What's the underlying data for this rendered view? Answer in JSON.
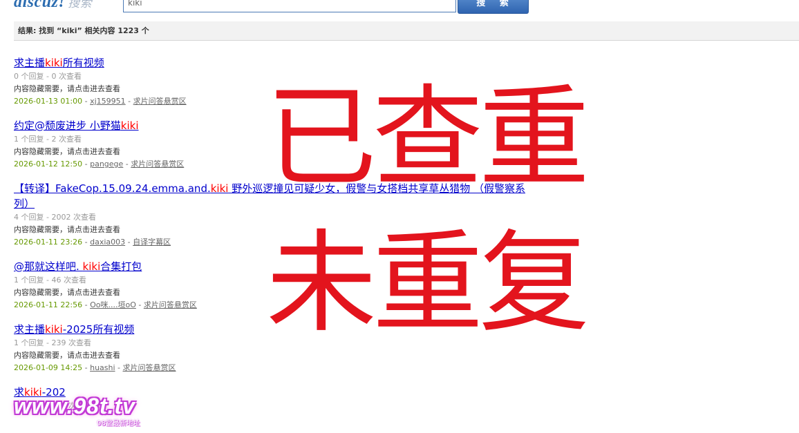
{
  "header": {
    "logo_text": "discuz!",
    "logo_sub": "搜索",
    "search_value": "kiki",
    "search_button": "搜 索"
  },
  "result_summary": "结果: 找到 “kiki” 相关内容 1223 个",
  "results": [
    {
      "title_pre": "求主播",
      "title_hl": "kiki",
      "title_post": "所有视频",
      "stats": "0 个回复 - 0 次查看",
      "desc": "内容隐藏需要，请点击进去查看",
      "date": "2026-01-13 01:00",
      "author": "xj159951",
      "forum": "求片问答悬赏区"
    },
    {
      "title_pre": "约定@颓废进步 小野猫",
      "title_hl": "kiki",
      "title_post": "",
      "stats": "1 个回复 - 2 次查看",
      "desc": "内容隐藏需要，请点击进去查看",
      "date": "2026-01-12 12:50",
      "author": "pangege",
      "forum": "求片问答悬赏区"
    },
    {
      "title_pre": "【转译】FakeCop.15.09.24.emma.and.",
      "title_hl": "kiki",
      "title_post": " 野外巡逻撞见可疑少女，假警与女搭档共享草丛猎物 （假警察系列）",
      "stats": "4 个回复 - 2002 次查看",
      "desc": "内容隐藏需要，请点击进去查看",
      "date": "2026-01-11 23:26",
      "author": "daxia003",
      "forum": "自译字幕区"
    },
    {
      "title_pre": "@那就这样吧. ",
      "title_hl": "kiki",
      "title_post": "合集打包",
      "stats": "1 个回复 - 46 次查看",
      "desc": "内容隐藏需要，请点击进去查看",
      "date": "2026-01-11 22:56",
      "author": "Oo咪....垣oO",
      "forum": "求片问答悬赏区"
    },
    {
      "title_pre": "求主播",
      "title_hl": "kiki",
      "title_post": "-2025所有视频",
      "stats": "1 个回复 - 239 次查看",
      "desc": "内容隐藏需要，请点击进去查看",
      "date": "2026-01-09 14:25",
      "author": "huashi",
      "forum": "求片问答悬赏区"
    },
    {
      "title_pre": "求",
      "title_hl": "kiki",
      "title_post": "-202",
      "stats": "0 个回复 - 203 次查看",
      "desc": "",
      "date": "",
      "author": "",
      "forum": ""
    }
  ],
  "overlay": {
    "line1": "已查重",
    "line2": "未重复",
    "color": "#e3141d"
  },
  "watermark": {
    "text": "www.98t.tv",
    "sub": "98堂最新地址"
  }
}
